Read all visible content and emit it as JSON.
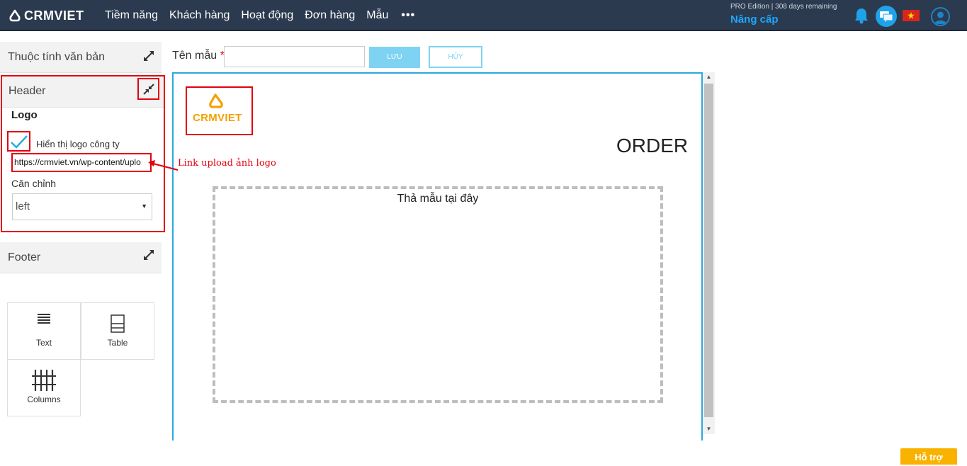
{
  "app": {
    "logo_text": "CRMVIET"
  },
  "nav": {
    "items": [
      "Tiềm năng",
      "Khách hàng",
      "Hoạt động",
      "Đơn hàng",
      "Mẫu"
    ],
    "more": "•••"
  },
  "account": {
    "edition": "PRO Edition | 308 days remaining",
    "upgrade": "Nâng cấp"
  },
  "icons": {
    "bell": "bell-icon",
    "chat": "chat-icon",
    "flag": "vietnam-flag-icon",
    "avatar": "user-avatar-icon"
  },
  "left_panel": {
    "doc_props_title": "Thuộc tính văn bản",
    "header": {
      "title": "Header",
      "logo_label": "Logo",
      "show_logo_label": "Hiển thị logo công ty",
      "show_logo_checked": true,
      "logo_url": "https://crmviet.vn/wp-content/uplo",
      "align_label": "Căn chỉnh",
      "align_value": "left"
    },
    "footer_title": "Footer",
    "tiles": [
      {
        "label": "Text",
        "icon": "text-lines-icon"
      },
      {
        "label": "Table",
        "icon": "table-icon"
      },
      {
        "label": "Columns",
        "icon": "columns-icon"
      }
    ]
  },
  "editor": {
    "name_label": "Tên mẫu",
    "required_mark": "*",
    "name_value": "",
    "save_label": "LƯU",
    "cancel_label": "HỦY",
    "canvas_logo_text": "CRMVIET",
    "order_title": "ORDER",
    "drop_text": "Thả mẫu tại đây"
  },
  "annotation": {
    "text": "Link upload ảnh logo",
    "color": "#e3000f"
  },
  "support_label": "Hỗ trợ",
  "colors": {
    "topbar": "#2b3a4f",
    "accent": "#29a9e0",
    "upgrade": "#1ea7ff",
    "support": "#f9b200"
  }
}
